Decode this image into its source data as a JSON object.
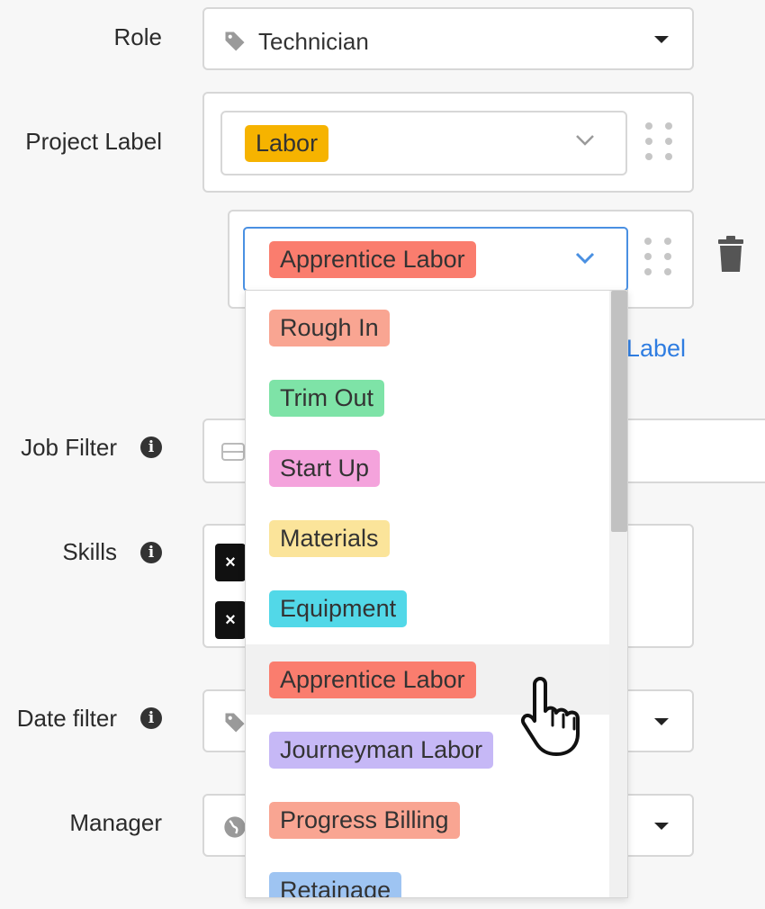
{
  "form": {
    "role": {
      "label": "Role",
      "value": "Technician",
      "icon": "tag-icon"
    },
    "project_label": {
      "label": "Project Label",
      "primary_value": "Labor",
      "secondary_value": "Apprentice Labor",
      "add_link_partial": "Label"
    },
    "job_filter": {
      "label": "Job Filter"
    },
    "skills": {
      "label": "Skills",
      "chip_remove_glyph": "×"
    },
    "date_filter": {
      "label": "Date filter"
    },
    "manager": {
      "label": "Manager"
    }
  },
  "dropdown": {
    "items": [
      {
        "label": "Rough In",
        "color": "#f9a592"
      },
      {
        "label": "Trim Out",
        "color": "#7ee3a7"
      },
      {
        "label": "Start Up",
        "color": "#f4a3dc"
      },
      {
        "label": "Materials",
        "color": "#fbe49a"
      },
      {
        "label": "Equipment",
        "color": "#52d8e8"
      },
      {
        "label": "Apprentice Labor",
        "color": "#fa7d6e"
      },
      {
        "label": "Journeyman Labor",
        "color": "#c6b8f6"
      },
      {
        "label": "Progress Billing",
        "color": "#f9a592"
      },
      {
        "label": "Retainage",
        "color": "#9ec4f2"
      }
    ],
    "hovered_index": 5
  },
  "colors": {
    "labor": "#f6b300",
    "apprentice_labor": "#fa7d6e",
    "focus_border": "#4a90e2",
    "link": "#2f7de1"
  }
}
